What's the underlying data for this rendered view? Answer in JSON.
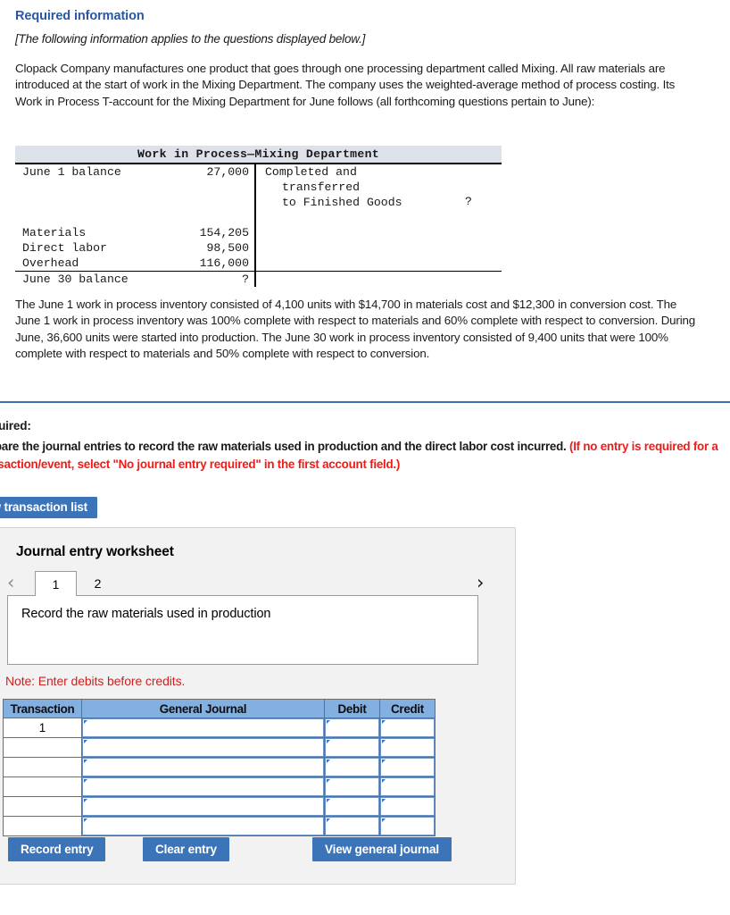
{
  "section": {
    "heading": "Required information",
    "applies_note": "[The following information applies to the questions displayed below.]",
    "intro_paragraph": "Clopack Company manufactures one product that goes through one processing department called Mixing. All raw materials are introduced at the start of work in the Mixing Department. The company uses the weighted-average method of process costing. Its Work in Process T-account for the Mixing Department for June follows (all forthcoming questions pertain to June):",
    "second_paragraph": "The June 1 work in process inventory consisted of 4,100 units with $14,700 in materials cost and $12,300 in conversion cost. The June 1 work in process inventory was 100% complete with respect to materials and 60% complete with respect to conversion. During June, 36,600 units were started into production. The June 30 work in process inventory consisted of 9,400 units that were 100% complete with respect to materials and 50% complete with respect to conversion."
  },
  "taccount": {
    "title": "Work in Process—Mixing Department",
    "debit_rows": [
      {
        "label": "June 1 balance",
        "amount": "27,000"
      },
      {
        "label": "Materials",
        "amount": "154,205"
      },
      {
        "label": "Direct labor",
        "amount": "98,500"
      },
      {
        "label": "Overhead",
        "amount": "116,000"
      }
    ],
    "footer_row": {
      "label": "June 30 balance",
      "amount": "?"
    },
    "credit_lines": [
      "Completed and",
      "transferred",
      "to Finished Goods"
    ],
    "credit_amount": "?"
  },
  "required": {
    "label": "Required:",
    "prompt_plain": "Prepare the journal entries to record the raw materials used in production and the direct labor cost incurred. ",
    "prompt_red": "(If no entry is required for a transaction/event, select \"No journal entry required\" in the first account field.)",
    "view_transaction_button": "View transaction list"
  },
  "worksheet": {
    "title": "Journal entry worksheet",
    "prev_chevron": "‹",
    "next_chevron": "›",
    "tabs": [
      {
        "label": "1",
        "active": true
      },
      {
        "label": "2",
        "active": false
      }
    ],
    "description": "Record the raw materials used in production",
    "note": "Note: Enter debits before credits.",
    "table": {
      "headers": [
        "Transaction",
        "General Journal",
        "Debit",
        "Credit"
      ],
      "rows": [
        {
          "transaction": "1",
          "general_journal": "",
          "debit": "",
          "credit": ""
        },
        {
          "transaction": "",
          "general_journal": "",
          "debit": "",
          "credit": ""
        },
        {
          "transaction": "",
          "general_journal": "",
          "debit": "",
          "credit": ""
        },
        {
          "transaction": "",
          "general_journal": "",
          "debit": "",
          "credit": ""
        },
        {
          "transaction": "",
          "general_journal": "",
          "debit": "",
          "credit": ""
        },
        {
          "transaction": "",
          "general_journal": "",
          "debit": "",
          "credit": ""
        }
      ]
    },
    "buttons": {
      "record": "Record entry",
      "clear": "Clear entry",
      "view_journal": "View general journal"
    }
  },
  "colors": {
    "heading_blue": "#2a57a5",
    "accent_blue": "#3c74ba",
    "table_header_blue": "#83b0e0",
    "alert_red": "#ee1c18",
    "note_red": "#cc2222",
    "panel_grey": "#f2f2f2",
    "taccount_header_grey": "#dde1e9"
  }
}
